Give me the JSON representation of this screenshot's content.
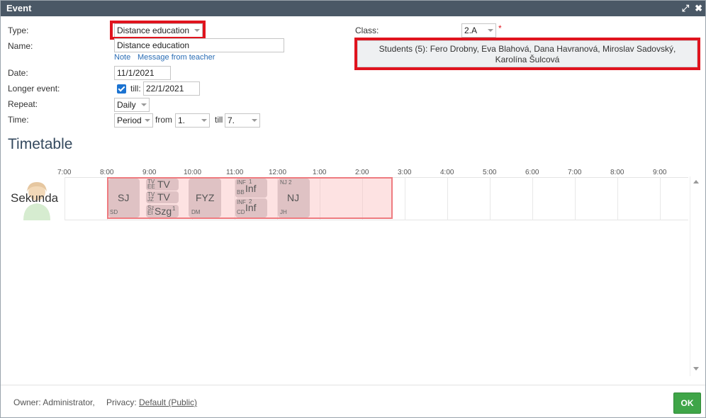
{
  "window": {
    "title": "Event"
  },
  "form": {
    "type_label": "Type:",
    "type_value": "Distance education",
    "name_label": "Name:",
    "name_value": "Distance education",
    "links": {
      "note": "Note",
      "message": "Message from teacher"
    },
    "date_label": "Date:",
    "date_value": "11/1/2021",
    "longer_label": "Longer event:",
    "till_label": "till:",
    "till_value": "22/1/2021",
    "repeat_label": "Repeat:",
    "repeat_value": "Daily",
    "time_label": "Time:",
    "time_mode": "Period",
    "from_label": "from",
    "from_value": "1.",
    "till2_label": "till",
    "till2_value": "7.",
    "class_label": "Class:",
    "class_value": "2.A",
    "required_mark": "*",
    "students_line1": "Students (5): Fero Drobny, Eva Blahová, Dana Havranová, Miroslav Sadovský,",
    "students_line2": "Karolína Šulcová"
  },
  "timetable": {
    "title": "Timetable",
    "hours": [
      "7:00",
      "8:00",
      "9:00",
      "10:00",
      "11:00",
      "12:00",
      "1:00",
      "2:00",
      "3:00",
      "4:00",
      "5:00",
      "6:00",
      "7:00",
      "8:00",
      "9:00"
    ],
    "class_name": "Sekunda",
    "lessons": {
      "sj": {
        "subject": "SJ",
        "teacher": "SD"
      },
      "tv1": {
        "subject": "TV",
        "tag": "TV EE"
      },
      "tv2": {
        "subject": "TV",
        "tag": "TV JZ"
      },
      "szg": {
        "subject": "Szg",
        "tag": "Sz EI",
        "sup": "1"
      },
      "fyz": {
        "subject": "FYZ",
        "teacher": "DM"
      },
      "inf1": {
        "subject": "Inf",
        "tag": "INF",
        "teacher": "BB",
        "sup": "1"
      },
      "inf2": {
        "subject": "Inf",
        "tag": "INF",
        "teacher": "CD",
        "sup": "2"
      },
      "nj": {
        "subject": "NJ",
        "tag": "NJ 2",
        "teacher": "JH"
      }
    }
  },
  "footer": {
    "owner": "Owner: Administrator,",
    "privacy_label": "Privacy:",
    "privacy_value": "Default (Public)",
    "ok": "OK"
  },
  "colors": {
    "titlebar": "#4a5866",
    "highlight": "#e0141e",
    "ok": "#3fa548",
    "event_span": "#fabebe"
  }
}
